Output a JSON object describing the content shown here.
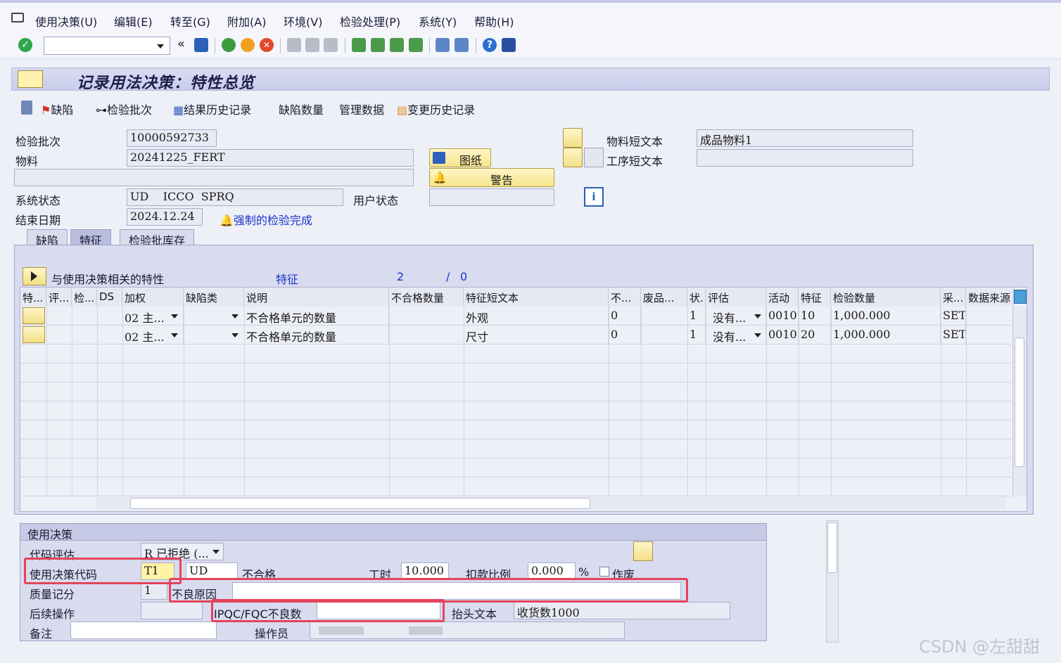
{
  "menu": [
    "使用决策(U)",
    "编辑(E)",
    "转至(G)",
    "附加(A)",
    "环境(V)",
    "检验处理(P)",
    "系统(Y)",
    "帮助(H)"
  ],
  "title": "记录用法决策：特性总览",
  "app_toolbar": {
    "defects": "缺陷",
    "inspection_lot": "检验批次",
    "result_history": "结果历史记录",
    "defect_qty": "缺陷数量",
    "admin_data": "管理数据",
    "change_history": "变更历史记录"
  },
  "header": {
    "lot_label": "检验批次",
    "lot_value": "10000592733",
    "material_label": "物料",
    "material_value": "20241225_FERT",
    "sys_status_label": "系统状态",
    "sys_status_value": "UD    ICCO  SPRQ",
    "user_status_label": "用户状态",
    "end_date_label": "结束日期",
    "end_date_value": "2024.12.24",
    "forced_completion": "强制的检验完成",
    "drawing_btn": "图纸",
    "warning_btn": "警告",
    "mat_short_label": "物料短文本",
    "mat_short_value": "成品物料1",
    "op_short_label": "工序短文本"
  },
  "tabs": [
    "缺陷",
    "特征",
    "检验批库存"
  ],
  "section": {
    "label": "与使用决策相关的特性",
    "char_label": "特征",
    "count": "2",
    "sep": "/",
    "total": "0"
  },
  "columns": [
    "特...",
    "评...",
    "检...",
    "DS",
    "加权",
    "缺陷类",
    "说明",
    "不合格数量",
    "特征短文本",
    "不...",
    "废品...",
    "状.",
    "评估",
    "活动",
    "特征",
    "检验数量",
    "采...",
    "数据来源"
  ],
  "rows": [
    {
      "weight": "02  主...",
      "desc": "不合格单元的数量",
      "short": "外观",
      "nonconf": "0",
      "status": "1",
      "eval": "没有...",
      "activity": "0010",
      "char": "10",
      "qty": "1,000.000",
      "sampling": "SET"
    },
    {
      "weight": "02  主...",
      "desc": "不合格单元的数量",
      "short": "尺寸",
      "nonconf": "0",
      "status": "1",
      "eval": "没有...",
      "activity": "0010",
      "char": "20",
      "qty": "1,000.000",
      "sampling": "SET"
    }
  ],
  "decision": {
    "group_title": "使用决策",
    "code_eval_label": "代码评估",
    "code_eval_value": "R 已拒绝 (...",
    "ud_code_label": "使用决策代码",
    "ud_code_value": "T1",
    "ud_code2": "UD",
    "ud_text": "不合格",
    "hours_label": "工时",
    "hours_value": "10.000",
    "deduct_label": "扣款比例",
    "deduct_value": "0.000",
    "percent": "%",
    "void_label": "作废",
    "score_label": "质量记分",
    "score_value": "1",
    "defect_reason_label": "不良原因",
    "follow_label": "后续操作",
    "ipqc_label": "IPQC/FQC不良数",
    "head_text_label": "抬头文本",
    "head_text_value": "收货数1000",
    "remark_label": "备注",
    "operator_label": "操作员"
  },
  "watermark": "CSDN @左甜甜",
  "colors": {
    "accent_red": "#e5435a",
    "link_blue": "#1a33cc"
  }
}
